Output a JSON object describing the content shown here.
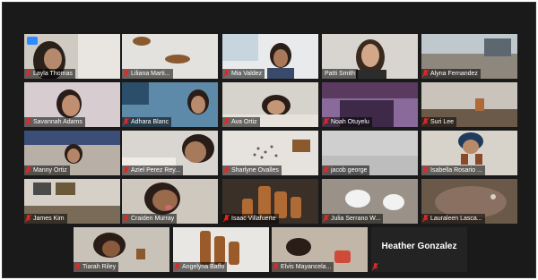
{
  "meeting": {
    "colors": {
      "active_speaker": "#c8d62a",
      "muted_icon": "#e02828",
      "background": "#1a1a1a"
    },
    "participants": [
      {
        "name": "Layla Thomas",
        "muted": true
      },
      {
        "name": "Liliana Marti...",
        "muted": true
      },
      {
        "name": "Mia Valdez",
        "muted": true
      },
      {
        "name": "Patti Smith",
        "muted": false,
        "active_speaker": true
      },
      {
        "name": "Alyna Fernandez",
        "muted": true
      },
      {
        "name": "Savannah Adams",
        "muted": true
      },
      {
        "name": "Adhara Blanc",
        "muted": true
      },
      {
        "name": "Ava Ortiz",
        "muted": true
      },
      {
        "name": "Noah Otuyelu",
        "muted": true
      },
      {
        "name": "Suri Lee",
        "muted": true
      },
      {
        "name": "Manny Ortiz",
        "muted": true
      },
      {
        "name": "Aziel Perez Rey...",
        "muted": true
      },
      {
        "name": "Sharlyne Ovalles",
        "muted": true
      },
      {
        "name": "jacob george",
        "muted": true
      },
      {
        "name": "Isabella Rosario ...",
        "muted": true
      },
      {
        "name": "James Kim",
        "muted": true
      },
      {
        "name": "Craiden Murray",
        "muted": true
      },
      {
        "name": "Isaac Villafuerte",
        "muted": true
      },
      {
        "name": "Julia Serrano W...",
        "muted": true
      },
      {
        "name": "Lauraleen Lasca...",
        "muted": true
      },
      {
        "name": "Tiarah Riley",
        "muted": true
      },
      {
        "name": "Angelyna Baffo",
        "muted": true
      },
      {
        "name": "Elvis Mayancela...",
        "muted": true
      },
      {
        "name": "Heather Gonzalez",
        "muted": true,
        "video_off": true
      }
    ]
  }
}
